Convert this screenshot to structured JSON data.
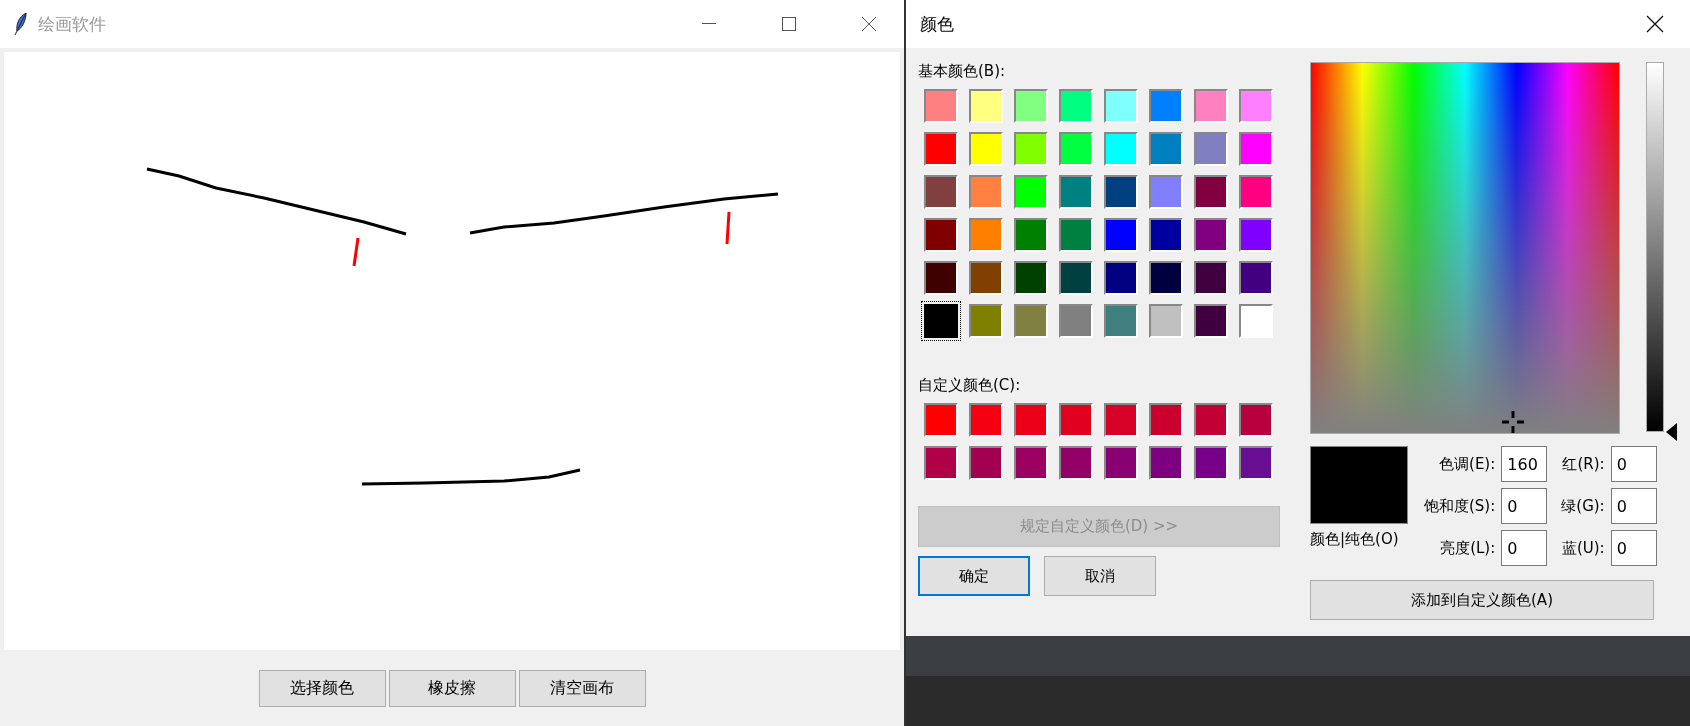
{
  "paint_window": {
    "title": "绘画软件",
    "buttons": [
      "选择颜色",
      "橡皮擦",
      "清空画布"
    ]
  },
  "color_dialog": {
    "title": "颜色",
    "basic_label": "基本颜色(B):",
    "basic_colors": [
      {
        "color": "#ff8080",
        "selected": false
      },
      {
        "color": "#ffff80",
        "selected": false
      },
      {
        "color": "#80ff80",
        "selected": false
      },
      {
        "color": "#00ff80",
        "selected": false
      },
      {
        "color": "#80ffff",
        "selected": false
      },
      {
        "color": "#0080ff",
        "selected": false
      },
      {
        "color": "#ff80c0",
        "selected": false
      },
      {
        "color": "#ff80ff",
        "selected": false
      },
      {
        "color": "#ff0000",
        "selected": false
      },
      {
        "color": "#ffff00",
        "selected": false
      },
      {
        "color": "#80ff00",
        "selected": false
      },
      {
        "color": "#00ff40",
        "selected": false
      },
      {
        "color": "#00ffff",
        "selected": false
      },
      {
        "color": "#0080c0",
        "selected": false
      },
      {
        "color": "#8080c0",
        "selected": false
      },
      {
        "color": "#ff00ff",
        "selected": false
      },
      {
        "color": "#804040",
        "selected": false
      },
      {
        "color": "#ff8040",
        "selected": false
      },
      {
        "color": "#00ff00",
        "selected": false
      },
      {
        "color": "#008080",
        "selected": false
      },
      {
        "color": "#004080",
        "selected": false
      },
      {
        "color": "#8080ff",
        "selected": false
      },
      {
        "color": "#800040",
        "selected": false
      },
      {
        "color": "#ff0080",
        "selected": false
      },
      {
        "color": "#800000",
        "selected": false
      },
      {
        "color": "#ff8000",
        "selected": false
      },
      {
        "color": "#008000",
        "selected": false
      },
      {
        "color": "#008040",
        "selected": false
      },
      {
        "color": "#0000ff",
        "selected": false
      },
      {
        "color": "#0000a0",
        "selected": false
      },
      {
        "color": "#800080",
        "selected": false
      },
      {
        "color": "#8000ff",
        "selected": false
      },
      {
        "color": "#400000",
        "selected": false
      },
      {
        "color": "#804000",
        "selected": false
      },
      {
        "color": "#004000",
        "selected": false
      },
      {
        "color": "#004040",
        "selected": false
      },
      {
        "color": "#000080",
        "selected": false
      },
      {
        "color": "#000040",
        "selected": false
      },
      {
        "color": "#400040",
        "selected": false
      },
      {
        "color": "#400080",
        "selected": false
      },
      {
        "color": "#000000",
        "selected": true
      },
      {
        "color": "#808000",
        "selected": false
      },
      {
        "color": "#808040",
        "selected": false
      },
      {
        "color": "#808080",
        "selected": false
      },
      {
        "color": "#408080",
        "selected": false
      },
      {
        "color": "#c0c0c0",
        "selected": false
      },
      {
        "color": "#400040",
        "selected": false
      },
      {
        "color": "#ffffff",
        "selected": false
      }
    ],
    "custom_label": "自定义颜色(C):",
    "custom_colors": [
      {
        "color": "#ff0000"
      },
      {
        "color": "#f50012"
      },
      {
        "color": "#ec0018"
      },
      {
        "color": "#e1001e"
      },
      {
        "color": "#d70026"
      },
      {
        "color": "#cc002e"
      },
      {
        "color": "#c20036"
      },
      {
        "color": "#b8003e"
      },
      {
        "color": "#b00048"
      },
      {
        "color": "#a40050"
      },
      {
        "color": "#9c0060"
      },
      {
        "color": "#920068"
      },
      {
        "color": "#880072"
      },
      {
        "color": "#7c0080"
      },
      {
        "color": "#780088"
      },
      {
        "color": "#680f94"
      }
    ],
    "define_button": {
      "label": "规定自定义颜色(D) >>",
      "disabled": true
    },
    "ok_button": "确定",
    "cancel_button": "取消",
    "preview": {
      "color": "#000000",
      "label": "颜色|纯色(O)"
    },
    "hsl_fields": [
      {
        "label": "色调(E):",
        "value": "160"
      },
      {
        "label": "饱和度(S):",
        "value": "0"
      },
      {
        "label": "亮度(L):",
        "value": "0"
      }
    ],
    "rgb_fields": [
      {
        "label": "红(R):",
        "value": "0"
      },
      {
        "label": "绿(G):",
        "value": "0"
      },
      {
        "label": "蓝(U):",
        "value": "0"
      }
    ],
    "add_button": "添加到自定义颜色(A)"
  }
}
